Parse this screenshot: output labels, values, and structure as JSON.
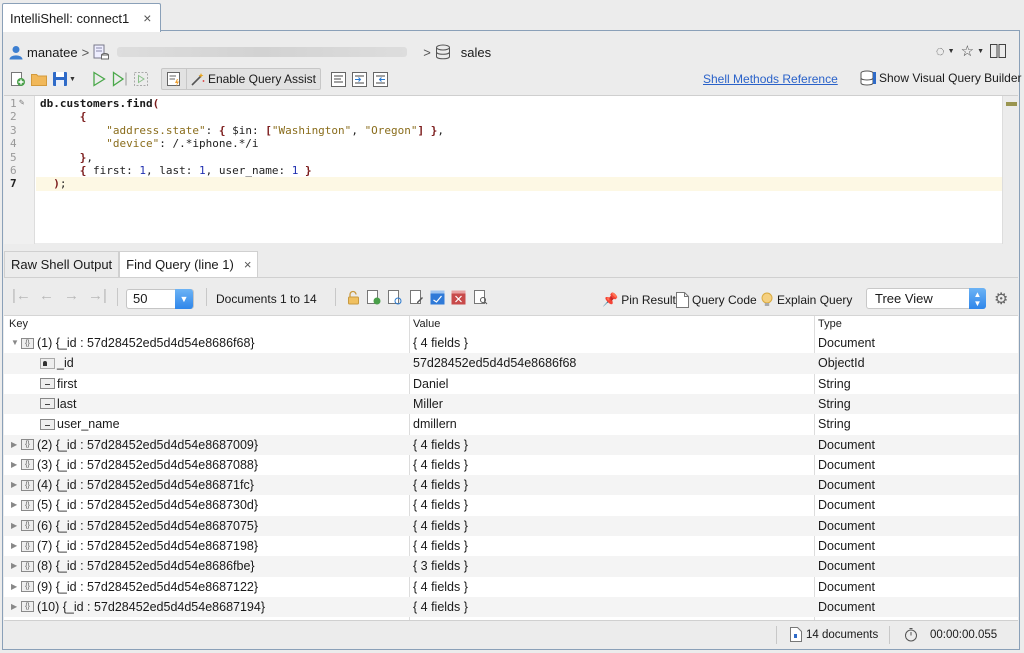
{
  "window_tab": {
    "title": "IntelliShell: connect1",
    "close": "×"
  },
  "breadcrumb": {
    "user": "manatee",
    "sep": ">",
    "database": "sales"
  },
  "toolbar": {
    "query_assist_label": "Enable Query Assist",
    "shell_methods_link": "Shell Methods Reference",
    "visual_query_builder": "Show Visual Query Builder"
  },
  "editor": {
    "current_line": 7,
    "line_numbers": [
      "1",
      "2",
      "3",
      "4",
      "5",
      "6",
      "7"
    ],
    "lines": [
      "db.customers.find(",
      "      {",
      "          \"address.state\": { $in: [\"Washington\", \"Oregon\"] },",
      "          \"device\": /.*iphone.*/i",
      "      },",
      "      { first: 1, last: 1, user_name: 1 }",
      "  );"
    ]
  },
  "result_tabs": [
    {
      "label": "Raw Shell Output",
      "active": false
    },
    {
      "label": "Find Query (line 1)",
      "active": true,
      "close": "×"
    }
  ],
  "results_toolbar": {
    "page_size": "50",
    "doc_range": "Documents 1 to 14",
    "pin_result": "Pin Result",
    "query_code": "Query Code",
    "explain_query": "Explain Query",
    "view_mode": "Tree View"
  },
  "table": {
    "columns": [
      "Key",
      "Value",
      "Type"
    ],
    "rows": [
      {
        "key": "(1) {_id : 57d28452ed5d4d54e8686f68}",
        "value": "{ 4 fields }",
        "type": "Document",
        "level": 0,
        "expanded": true,
        "kind": "doc"
      },
      {
        "key": "_id",
        "value": "57d28452ed5d4d54e8686f68",
        "type": "ObjectId",
        "level": 1,
        "kind": "id"
      },
      {
        "key": "first",
        "value": "Daniel",
        "type": "String",
        "level": 1,
        "kind": "field"
      },
      {
        "key": "last",
        "value": "Miller",
        "type": "String",
        "level": 1,
        "kind": "field"
      },
      {
        "key": "user_name",
        "value": "dmillern",
        "type": "String",
        "level": 1,
        "kind": "field"
      },
      {
        "key": "(2) {_id : 57d28452ed5d4d54e8687009}",
        "value": "{ 4 fields }",
        "type": "Document",
        "level": 0,
        "kind": "doc"
      },
      {
        "key": "(3) {_id : 57d28452ed5d4d54e8687088}",
        "value": "{ 4 fields }",
        "type": "Document",
        "level": 0,
        "kind": "doc"
      },
      {
        "key": "(4) {_id : 57d28452ed5d4d54e86871fc}",
        "value": "{ 4 fields }",
        "type": "Document",
        "level": 0,
        "kind": "doc"
      },
      {
        "key": "(5) {_id : 57d28452ed5d4d54e868730d}",
        "value": "{ 4 fields }",
        "type": "Document",
        "level": 0,
        "kind": "doc"
      },
      {
        "key": "(6) {_id : 57d28452ed5d4d54e8687075}",
        "value": "{ 4 fields }",
        "type": "Document",
        "level": 0,
        "kind": "doc"
      },
      {
        "key": "(7) {_id : 57d28452ed5d4d54e8687198}",
        "value": "{ 4 fields }",
        "type": "Document",
        "level": 0,
        "kind": "doc"
      },
      {
        "key": "(8) {_id : 57d28452ed5d4d54e8686fbe}",
        "value": "{ 3 fields }",
        "type": "Document",
        "level": 0,
        "kind": "doc"
      },
      {
        "key": "(9) {_id : 57d28452ed5d4d54e8687122}",
        "value": "{ 4 fields }",
        "type": "Document",
        "level": 0,
        "kind": "doc"
      },
      {
        "key": "(10) {_id : 57d28452ed5d4d54e8687194}",
        "value": "{ 4 fields }",
        "type": "Document",
        "level": 0,
        "kind": "doc"
      }
    ]
  },
  "footer": {
    "doc_count": "14 documents",
    "elapsed": "00:00:00.055"
  }
}
